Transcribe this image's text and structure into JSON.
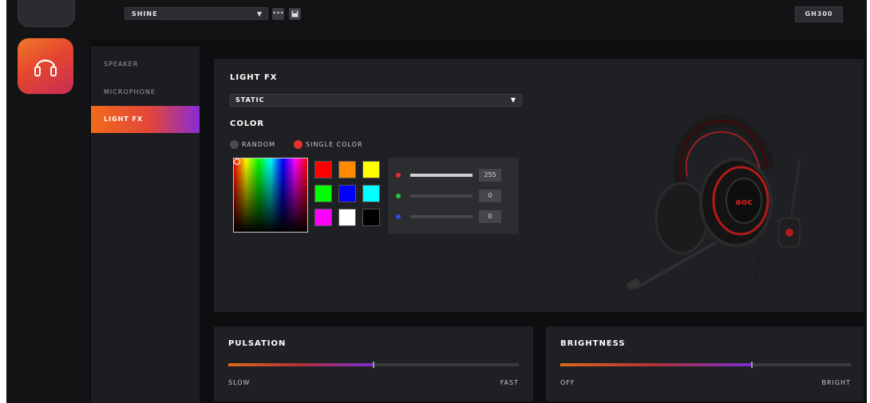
{
  "topbar": {
    "preset": "SHINE",
    "more_label": "•••",
    "model": "GH300"
  },
  "nav": {
    "items": [
      {
        "label": "SPEAKER"
      },
      {
        "label": "MICROPHONE"
      },
      {
        "label": "LIGHT FX"
      }
    ],
    "active_index": 2
  },
  "lightfx": {
    "title": "LIGHT FX",
    "mode": "STATIC",
    "color_title": "COLOR",
    "radio": {
      "random": "RANDOM",
      "single": "SINGLE COLOR",
      "selected": "single"
    },
    "swatches": [
      "#ff0000",
      "#ff8a00",
      "#ffff00",
      "#00ff00",
      "#0000ff",
      "#00ffff",
      "#ff00ff",
      "#ffffff",
      "#000000"
    ],
    "rgb": {
      "r": "255",
      "g": "0",
      "b": "0"
    }
  },
  "pulsation": {
    "title": "PULSATION",
    "min_label": "SLOW",
    "max_label": "FAST",
    "value": 0.5
  },
  "brightness": {
    "title": "BRIGHTNESS",
    "min_label": "OFF",
    "max_label": "BRIGHT",
    "value": 0.66
  },
  "colors": {
    "accent_orange": "#f26b1c",
    "accent_red": "#e1453a",
    "accent_purple": "#8a2bd6"
  },
  "icons": [
    "headset-icon",
    "chevron-down-icon",
    "more-icon",
    "save-icon"
  ]
}
